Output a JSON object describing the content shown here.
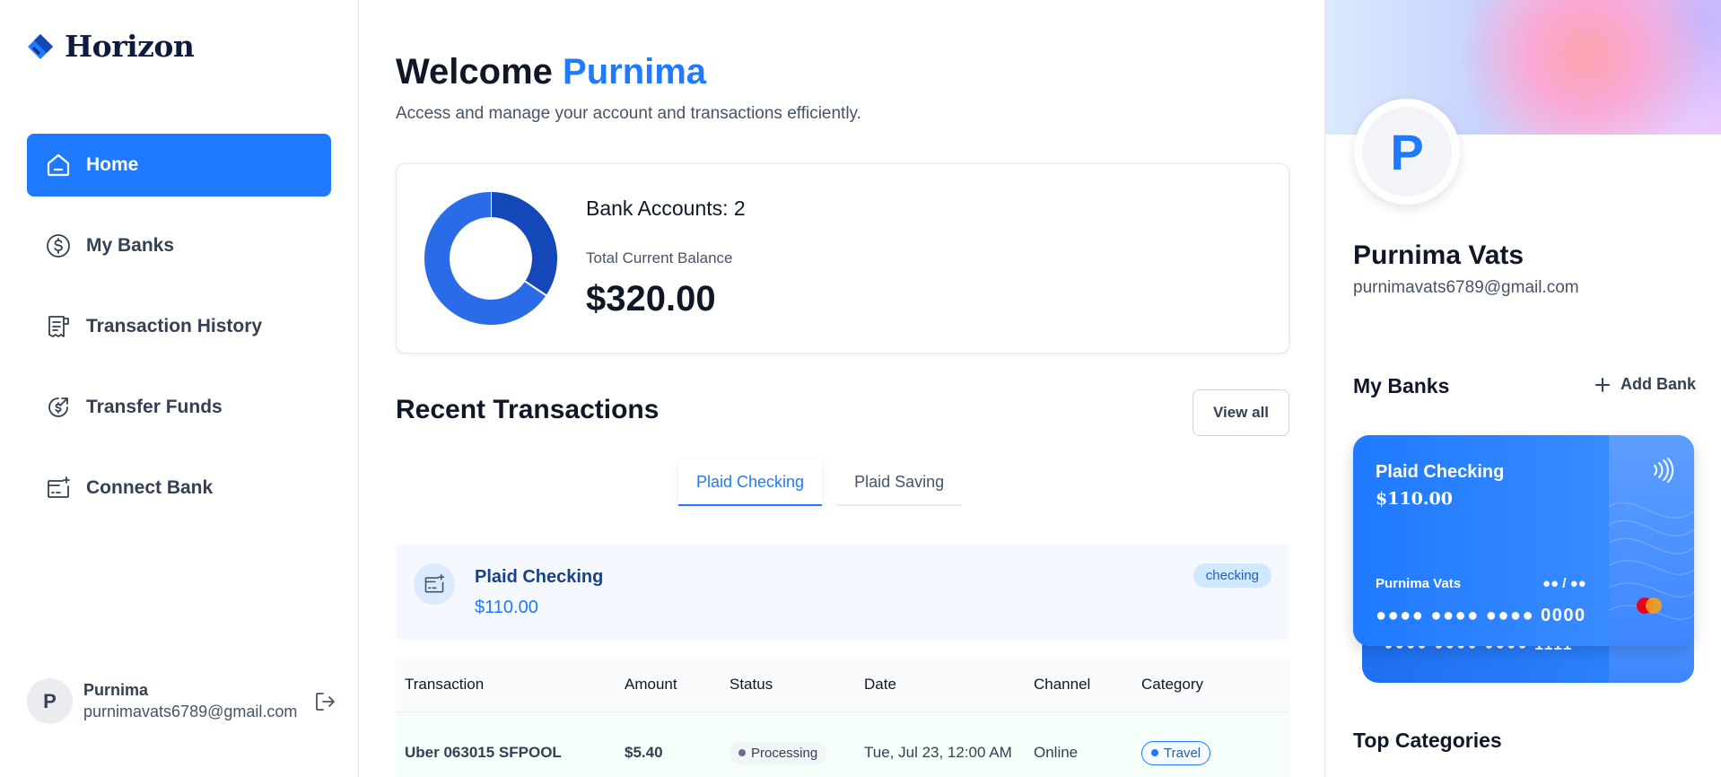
{
  "brand": {
    "name": "Horizon"
  },
  "sidebar": {
    "items": [
      {
        "label": "Home",
        "icon": "home-icon",
        "active": true
      },
      {
        "label": "My Banks",
        "icon": "dollar-circle-icon",
        "active": false
      },
      {
        "label": "Transaction History",
        "icon": "receipt-icon",
        "active": false
      },
      {
        "label": "Transfer Funds",
        "icon": "money-send-icon",
        "active": false
      },
      {
        "label": "Connect Bank",
        "icon": "connect-bank-icon",
        "active": false
      }
    ],
    "user": {
      "initial": "P",
      "name": "Purnima",
      "email": "purnimavats6789@gmail.com"
    }
  },
  "header": {
    "welcome": "Welcome",
    "user_name": "Purnima",
    "subtitle": "Access and manage your account and transactions efficiently."
  },
  "balance": {
    "bank_accounts": "Bank Accounts: 2",
    "total_label": "Total Current Balance",
    "total_value": "$320.00",
    "donut_values": [
      110,
      210
    ]
  },
  "recent": {
    "title": "Recent Transactions",
    "view_all": "View all",
    "tabs": [
      {
        "label": "Plaid Checking",
        "active": true
      },
      {
        "label": "Plaid Saving",
        "active": false
      }
    ],
    "bank_info": {
      "name": "Plaid Checking",
      "balance": "$110.00",
      "type": "checking"
    },
    "table": {
      "headers": [
        "Transaction",
        "Amount",
        "Status",
        "Date",
        "Channel",
        "Category"
      ],
      "rows": [
        {
          "transaction": "Uber 063015 SFPOOL",
          "amount": "$5.40",
          "status": "Processing",
          "date": "Tue, Jul 23, 12:00 AM",
          "channel": "Online",
          "category": "Travel"
        }
      ]
    }
  },
  "profile": {
    "initial": "P",
    "name": "Purnima Vats",
    "email": "purnimavats6789@gmail.com"
  },
  "my_banks": {
    "title": "My Banks",
    "add_label": "Add Bank",
    "cards": [
      {
        "bank": "Plaid Checking",
        "balance": "$110.00",
        "holder": "Purnima Vats",
        "expiry": "●● / ●●",
        "number": "●●●● ●●●● ●●●● 0000"
      },
      {
        "number": "●●●● ●●●● ●●●● 1111"
      }
    ]
  },
  "top_categories": {
    "title": "Top Categories"
  },
  "colors": {
    "primary": "#1f7aff",
    "donut_dark": "#1447b8",
    "donut_light": "#2a6ce8"
  }
}
